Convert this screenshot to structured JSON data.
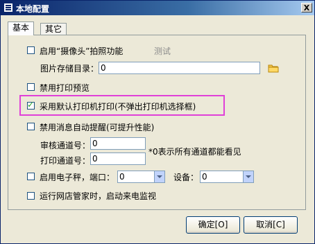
{
  "window": {
    "title": "本地配置",
    "close_label": "X"
  },
  "tabs": [
    {
      "label": "基本",
      "active": true
    },
    {
      "label": "其它",
      "active": false
    }
  ],
  "camera": {
    "checked": false,
    "label": "启用“摄像头”拍照功能",
    "test_label": "测试",
    "path_label": "图片存储目录：",
    "path_value": "0"
  },
  "print_preview": {
    "checked": false,
    "label": "禁用打印预览"
  },
  "default_printer": {
    "checked": true,
    "label": "采用默认打印机打印(不弹出打印机选择框)"
  },
  "notify": {
    "checked": false,
    "label": "禁用消息自动提醒(可提升性能)",
    "audit_label": "审核通道号：",
    "audit_value": "0",
    "print_label": "打印通道号：",
    "print_value": "0",
    "hint": "*0表示所有通道都能看见"
  },
  "scale": {
    "checked": false,
    "label": "启用电子秤，端口：",
    "port_value": "0",
    "device_label": "设备：",
    "device_value": "0"
  },
  "monitor": {
    "checked": false,
    "label": "运行网店管家时，启动来电监视"
  },
  "buttons": {
    "ok": "确定[O]",
    "cancel": "取消[C]"
  },
  "colors": {
    "titlebar": "#0a246a",
    "highlight": "#e040d8"
  }
}
